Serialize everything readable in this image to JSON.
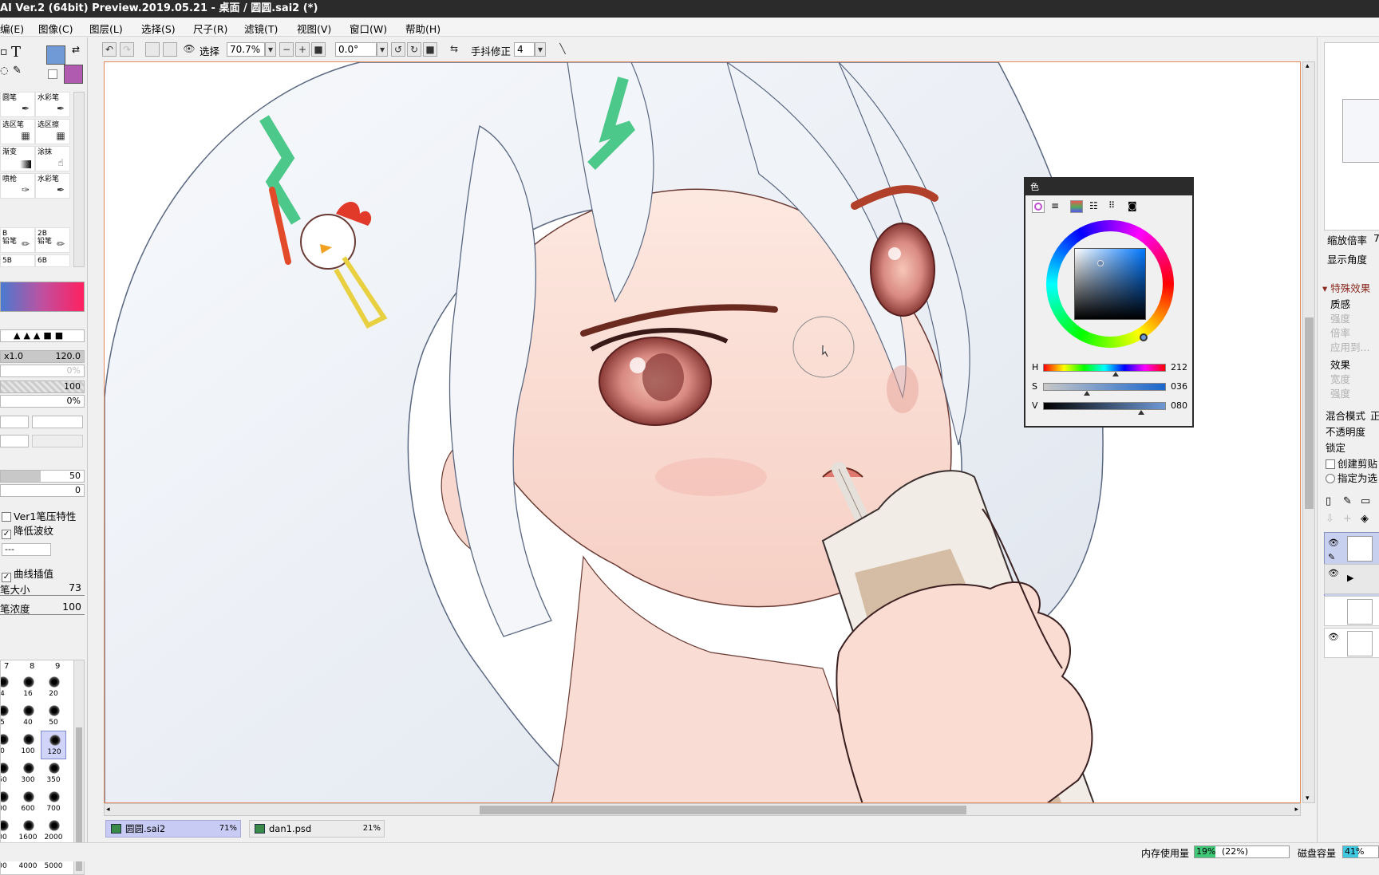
{
  "window": {
    "title": "AI Ver.2 (64bit) Preview.2019.05.21 - 桌面 / 圆圆.sai2 (*)"
  },
  "menu": [
    "编(E)",
    "图像(C)",
    "图层(L)",
    "选择(S)",
    "尺子(R)",
    "滤镜(T)",
    "视图(V)",
    "窗口(W)",
    "帮助(H)"
  ],
  "toolbar": {
    "select_label": "选择",
    "zoom": "70.7%",
    "rotation": "0.0°",
    "stabilizer_label": "手抖修正",
    "stabilizer_value": "4"
  },
  "tools": {
    "row1": [
      "圆笔",
      "水彩笔"
    ],
    "row2": [
      "选区笔",
      "选区擦"
    ],
    "row3": [
      "渐变",
      "涂抹"
    ],
    "row4": [
      "喷枪",
      "水彩笔"
    ],
    "row5": [
      "B\n铅笔",
      "2B\n铅笔"
    ],
    "row6": [
      "5B",
      "6B"
    ]
  },
  "brush_settings": {
    "size_multiplier": "x1.0",
    "size": "120.0",
    "min_size": "0%",
    "density": "100",
    "min_density": "0%",
    "blend_value": "50",
    "dilution_value": "0",
    "ver1_pressure": "Ver1笔压特性",
    "reduce_ripple": "降低波纹",
    "curve_interp": "曲线插值",
    "pen_size_label": "笔大小",
    "pen_size_value": "73",
    "pen_density_label": "笔浓度",
    "pen_density_value": "100",
    "select_dash": "---"
  },
  "brush_sizes": {
    "header": [
      "7",
      "8",
      "9"
    ],
    "rows": [
      [
        "4",
        "16",
        "20"
      ],
      [
        "5",
        "40",
        "50"
      ],
      [
        "0",
        "100",
        "120"
      ],
      [
        "50",
        "300",
        "350"
      ],
      [
        "00",
        "600",
        "700"
      ],
      [
        "00",
        "1600",
        "2000"
      ],
      [
        "00",
        "4000",
        "5000"
      ]
    ],
    "selected": "120"
  },
  "color_panel": {
    "title": "色",
    "h_label": "H",
    "h_value": "212",
    "s_label": "S",
    "s_value": "036",
    "v_label": "V",
    "v_value": "080",
    "h": 212,
    "s": 36,
    "v": 80
  },
  "right_panel": {
    "zoom_label": "缩放倍率",
    "zoom_value": "7",
    "angle_label": "显示角度",
    "effects_header": "特殊效果",
    "texture_label": "质感",
    "intensity_label": "强度",
    "scale_label": "倍率",
    "apply_label": "应用到...",
    "effect_label": "效果",
    "width_label": "宽度",
    "strength_label": "强度",
    "blend_mode_label": "混合模式",
    "blend_mode_value": "正",
    "opacity_label": "不透明度",
    "lock_label": "锁定",
    "clip_label": "创建剪贴",
    "select_source_label": "指定为选"
  },
  "tabs": [
    {
      "name": "圆圆.sai2",
      "percent": "71%"
    },
    {
      "name": "dan1.psd",
      "percent": "21%"
    }
  ],
  "status": {
    "memory_label": "内存使用量",
    "memory_value": "19%",
    "memory_detail": "(22%)",
    "disk_label": "磁盘容量",
    "disk_value": "41%"
  },
  "colors": {
    "primary": "#6f9ad6",
    "secondary": "#b05ab0",
    "canvas_border": "#e58a5a"
  }
}
